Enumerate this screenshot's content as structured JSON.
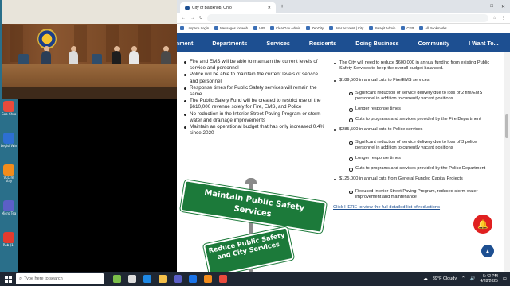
{
  "desktop": {
    "icons": [
      {
        "label": "Goo Chro",
        "color": "#e84a3c"
      },
      {
        "label": "Legisl Win",
        "color": "#2d6fd3"
      },
      {
        "label": "VLC m play",
        "color": "#f28c1c"
      },
      {
        "label": "Micro Tea",
        "color": "#5b5fc7"
      },
      {
        "label": "Rob (1)",
        "color": "#e33b2e"
      }
    ]
  },
  "browser": {
    "tab_title": "City of Baldknob, Ohio",
    "window_controls": [
      "–",
      "□",
      "✕"
    ],
    "bookmarks": [
      "...nspace Login",
      "Messages for web",
      "VIP",
      "ClearGov Admin",
      "ZenCity",
      "User account | City",
      "Swagit Admin",
      "CEP",
      "All Bookmarks"
    ]
  },
  "site": {
    "nav": [
      "rnment",
      "Departments",
      "Services",
      "Residents",
      "Doing Business",
      "Community",
      "I Want To..."
    ],
    "left_bullets": [
      "Fire and EMS will be able to maintain the current levels of service and personnel",
      "Police will be able to maintain the current levels of service and personnel",
      "Response times for Public Safety services will remain the same",
      "The Public Safety Fund will be created to restrict use of the $610,000 revenue solely for Fire, EMS, and Police",
      "No reduction in the Interior Street Paving Program or storm water and drainage improvements",
      "Maintain an operational budget that has only increased 0.4% since 2020"
    ],
    "sign_top": "Maintain Public Safety Services",
    "sign_bottom": "Reduce Public Safety and City Services",
    "right": {
      "intro": "The City will need to reduce $600,000 in annual funding from existing Public Safety Services to keep the overall budget balanced.",
      "fire_head": "$189,500 in annual cuts to Fire/EMS services",
      "fire_subs": [
        "Significant reduction of service delivery due to loss of 2 fire/EMS personnel in addition to currently vacant positions",
        "Longer response times",
        "Cuts to programs and services provided by the Fire Department"
      ],
      "police_head": "$285,500 in annual cuts to Police services",
      "police_subs": [
        "Significant reduction of service delivery due to loss of 3 police personnel in addition to currently vacant positions",
        "Longer response times",
        "Cuts to programs and services provided by the Police Department"
      ],
      "capital_head": "$125,000 in annual cuts from General Funded Capital Projects",
      "capital_subs": [
        "Reduced Interior Street Paving Program, reduced storm water improvement and maintenance"
      ],
      "link": "Click HERE to view the full detailed list of reductions"
    }
  },
  "taskbar": {
    "search_placeholder": "Type here to search",
    "weather": "39°F  Cloudy",
    "time": "5:42 PM",
    "date": "4/28/2025"
  },
  "colors": {
    "brand": "#1d4f91",
    "sign_green": "#1c7a3a",
    "alert_red": "#e02020"
  }
}
